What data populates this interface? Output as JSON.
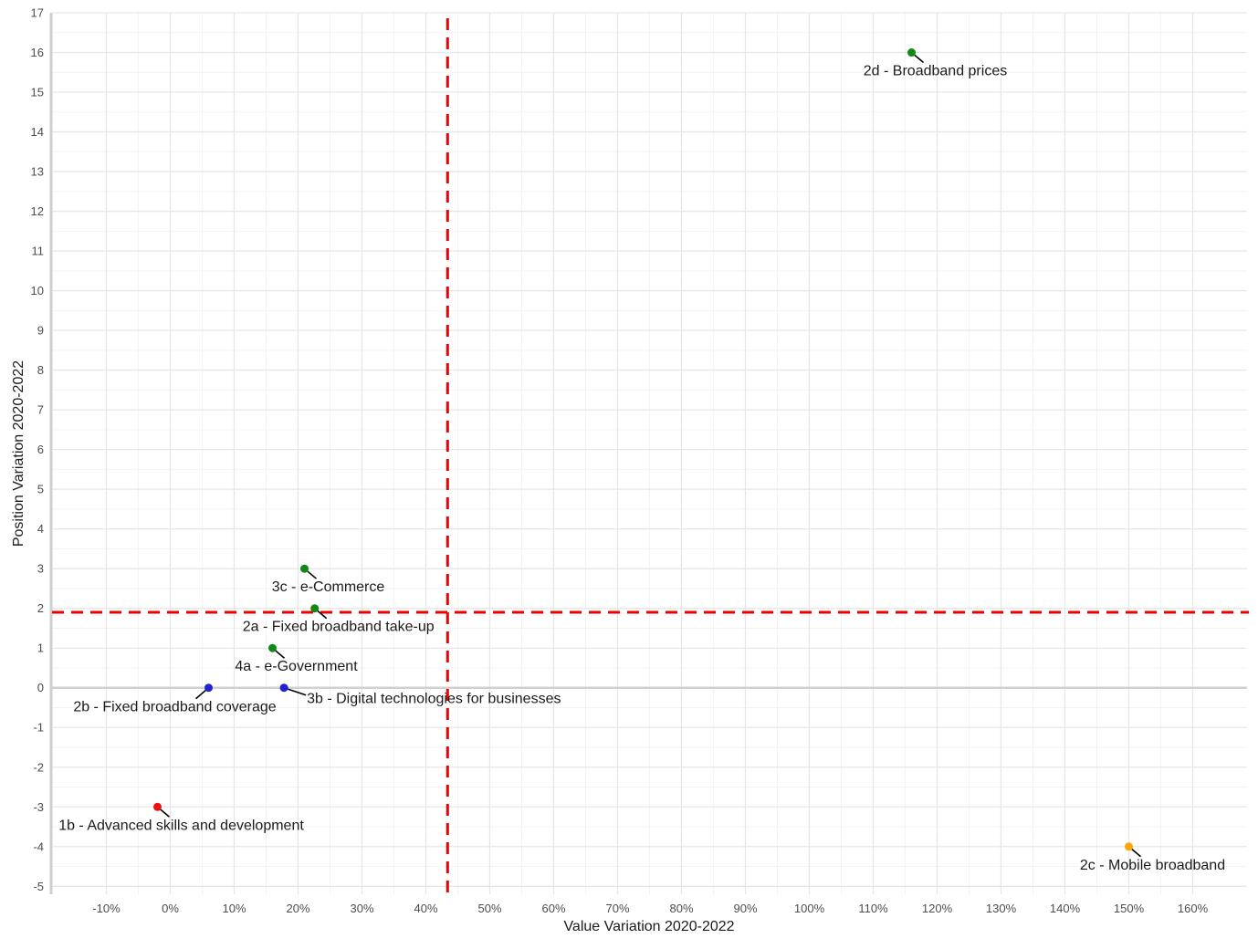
{
  "chart_data": {
    "type": "scatter",
    "xlabel": "Value Variation 2020-2022",
    "ylabel": "Position Variation 2020-2022",
    "xlim": [
      -0.185,
      1.685
    ],
    "ylim": [
      -5.2,
      17
    ],
    "x_ticks": [
      -0.1,
      0,
      0.1,
      0.2,
      0.3,
      0.4,
      0.5,
      0.6,
      0.7,
      0.8,
      0.9,
      1.0,
      1.1,
      1.2,
      1.3,
      1.4,
      1.5,
      1.6
    ],
    "x_tick_labels": [
      "-10%",
      "0%",
      "10%",
      "20%",
      "30%",
      "40%",
      "50%",
      "60%",
      "70%",
      "80%",
      "90%",
      "100%",
      "110%",
      "120%",
      "130%",
      "140%",
      "150%",
      "160%"
    ],
    "y_ticks": [
      -5,
      -4,
      -3,
      -2,
      -1,
      0,
      1,
      2,
      3,
      4,
      5,
      6,
      7,
      8,
      9,
      10,
      11,
      12,
      13,
      14,
      15,
      16,
      17
    ],
    "y_tick_labels": [
      "-5",
      "-4",
      "-3",
      "-2",
      "-1",
      "0",
      "1",
      "2",
      "3",
      "4",
      "5",
      "6",
      "7",
      "8",
      "9",
      "10",
      "11",
      "12",
      "13",
      "14",
      "15",
      "16",
      "17"
    ],
    "grid": true,
    "reference_lines": {
      "x": 0.434,
      "y": 1.9,
      "color": "#ee0000",
      "style": "dashed"
    },
    "points": [
      {
        "label": "2d - Broadband prices",
        "x": 1.16,
        "y": 16,
        "color": "#118811",
        "label_pos": "below"
      },
      {
        "label": "3c - e-Commerce",
        "x": 0.21,
        "y": 3,
        "color": "#118811",
        "label_pos": "below"
      },
      {
        "label": "2a - Fixed broadband take-up",
        "x": 0.226,
        "y": 2,
        "color": "#118811",
        "label_pos": "below"
      },
      {
        "label": "4a - e-Government",
        "x": 0.16,
        "y": 1,
        "color": "#118811",
        "label_pos": "below"
      },
      {
        "label": "2b - Fixed broadband coverage",
        "x": 0.06,
        "y": 0,
        "color": "#2222cc",
        "label_pos": "below-left"
      },
      {
        "label": "3b - Digital technologies for businesses",
        "x": 0.178,
        "y": 0,
        "color": "#2222cc",
        "label_pos": "right"
      },
      {
        "label": "1b - Advanced skills and development",
        "x": -0.02,
        "y": -3,
        "color": "#ee1111",
        "label_pos": "below"
      },
      {
        "label": "2c - Mobile broadband",
        "x": 1.5,
        "y": -4,
        "color": "#ffa500",
        "label_pos": "below"
      }
    ]
  }
}
